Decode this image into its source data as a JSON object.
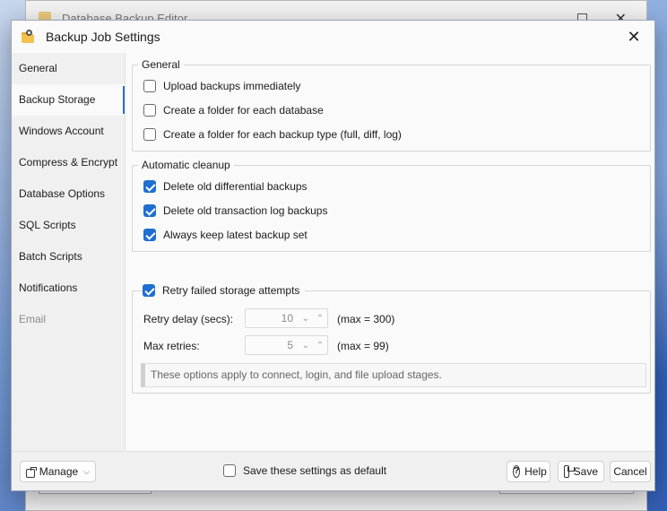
{
  "background_window": {
    "title": "Database Backup Editor"
  },
  "dialog": {
    "title": "Backup Job Settings",
    "close_glyph": "✕"
  },
  "sidebar": {
    "items": [
      {
        "label": "General",
        "state": "normal"
      },
      {
        "label": "Backup Storage",
        "state": "active"
      },
      {
        "label": "Windows Account",
        "state": "normal"
      },
      {
        "label": "Compress & Encrypt",
        "state": "normal"
      },
      {
        "label": "Database Options",
        "state": "normal"
      },
      {
        "label": "SQL Scripts",
        "state": "normal"
      },
      {
        "label": "Batch Scripts",
        "state": "normal"
      },
      {
        "label": "Notifications",
        "state": "normal"
      },
      {
        "label": "Email",
        "state": "disabled"
      }
    ]
  },
  "general_group": {
    "legend": "General",
    "options": [
      {
        "label": "Upload backups immediately",
        "checked": false
      },
      {
        "label": "Create a folder for each database",
        "checked": false
      },
      {
        "label": "Create a folder for each backup type (full, diff, log)",
        "checked": false
      }
    ]
  },
  "cleanup_group": {
    "legend": "Automatic cleanup",
    "options": [
      {
        "label": "Delete old differential backups",
        "checked": true
      },
      {
        "label": "Delete old transaction log backups",
        "checked": true
      },
      {
        "label": "Always keep latest backup set",
        "checked": true
      }
    ]
  },
  "retry_group": {
    "header_label": "Retry failed storage attempts",
    "header_checked": true,
    "delay": {
      "label": "Retry delay (secs):",
      "value": "10",
      "max_note": "(max = 300)"
    },
    "max_retries": {
      "label": "Max retries:",
      "value": "5",
      "max_note": "(max = 99)"
    },
    "info": "These options apply to connect, login, and file upload stages."
  },
  "footer": {
    "manage_label": "Manage",
    "default_label": "Save these settings as default",
    "default_checked": false,
    "help_label": "Help",
    "save_label": "Save",
    "cancel_label": "Cancel"
  },
  "colors": {
    "accent": "#1e6fd0",
    "nav_indicator": "#2b6dd1",
    "dialog_bg": "#fafafa",
    "sidebar_bg": "#f0f0f0"
  }
}
